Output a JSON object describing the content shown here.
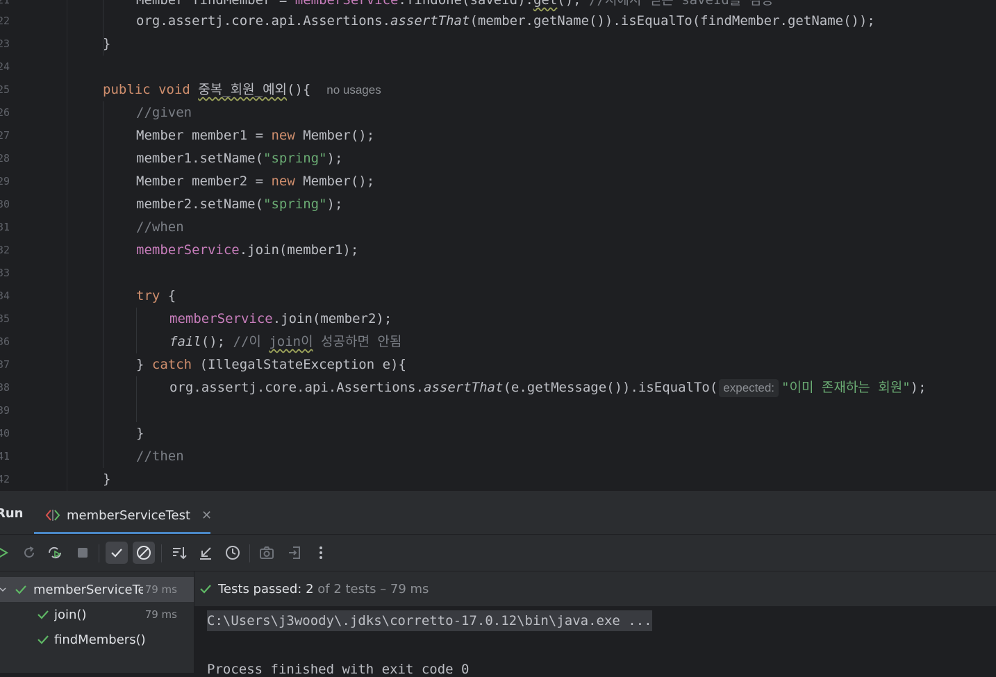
{
  "editor": {
    "line_numbers": [
      "21",
      "22",
      "23",
      "24",
      "25",
      "26",
      "27",
      "28",
      "29",
      "30",
      "31",
      "32",
      "33",
      "34",
      "35",
      "36",
      "37",
      "38",
      "39",
      "40",
      "41",
      "42"
    ],
    "line21": {
      "a": "Member findMember = ",
      "field": "memberService",
      "b": ".findOne(saveId).",
      "get": "get",
      "c": "(); ",
      "comment": "//저에서 얻은 saveId를 검증"
    },
    "line22": {
      "a": "org.assertj.core.api.Assertions.",
      "method": "assertThat",
      "b": "(member.getName()).isEqualTo(findMember.getName());"
    },
    "line23": "}",
    "line25": {
      "kw": "public void ",
      "method": "중복_회원_예외",
      "b": "(){",
      "hint": "no usages"
    },
    "line26": "//given",
    "line27": {
      "a": "Member member1 = ",
      "kw": "new",
      "b": " Member();"
    },
    "line28": {
      "a": "member1.setName(",
      "str": "\"spring\"",
      "b": ");"
    },
    "line29": {
      "a": "Member member2 = ",
      "kw": "new",
      "b": " Member();"
    },
    "line30": {
      "a": "member2.setName(",
      "str": "\"spring\"",
      "b": ");"
    },
    "line31": "//when",
    "line32": {
      "field": "memberService",
      "b": ".join(member1);"
    },
    "line34": {
      "kw": "try",
      "b": " {"
    },
    "line35": {
      "field": "memberService",
      "b": ".join(member2);"
    },
    "line36": {
      "method": "fail",
      "b": "(); ",
      "comment_a": "//이 ",
      "comment_join": "join이",
      "comment_b": " 성공하면 안됨"
    },
    "line37": {
      "a": "} ",
      "kw": "catch",
      "b": " (IllegalStateException e){"
    },
    "line38": {
      "a": "org.assertj.core.api.Assertions.",
      "method": "assertThat",
      "b": "(e.getMessage()).isEqualTo(",
      "hint": "expected:",
      "str": "\"이미 존재하는 회원\"",
      "c": ");"
    },
    "line40": "}",
    "line41": "//then",
    "line42": "}"
  },
  "run_panel": {
    "title": "Run",
    "tab_label": "memberServiceTest",
    "toolbar_icons": [
      "rerun-icon",
      "rerun-failed-icon",
      "toggle-auto-test-icon",
      "stop-icon",
      "show-passed-icon",
      "show-ignored-icon",
      "sort-icon",
      "collapse-icon",
      "history-icon",
      "screenshot-icon",
      "export-icon",
      "more-options-icon"
    ],
    "tree": [
      {
        "label": "memberServiceTest",
        "time": "79 ms"
      },
      {
        "label": "join()",
        "time": "79 ms"
      },
      {
        "label": "findMembers()",
        "time": ""
      }
    ],
    "status": {
      "prefix": "Tests passed:",
      "passed": "2",
      "rest": "of 2 tests – 79 ms"
    },
    "console": {
      "command": "C:\\Users\\j3woody\\.jdks\\corretto-17.0.12\\bin\\java.exe ...",
      "exit": "Process finished with exit code 0"
    }
  },
  "colors": {
    "editor_bg": "#1e1f22",
    "panel_bg": "#2b2d30",
    "keyword": "#cf8e6d",
    "field": "#c77dbb",
    "string": "#6aab73",
    "comment": "#7a7e85",
    "success": "#5fb865",
    "accent": "#4a88c7"
  }
}
